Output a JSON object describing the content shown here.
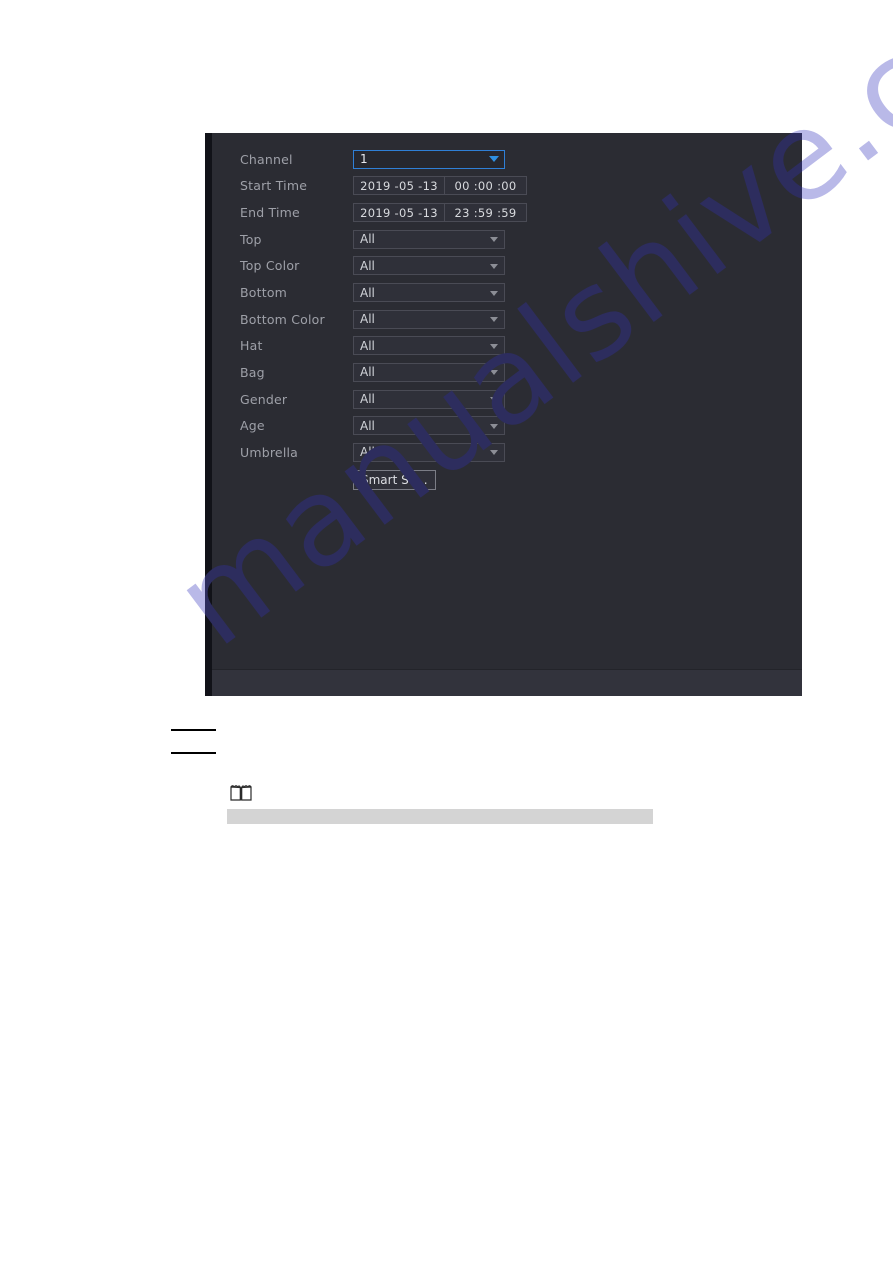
{
  "watermark": {
    "text": "manualshive.com",
    "color_on_white": "#b9b9e8",
    "color_on_dialog": "#2d2d5e"
  },
  "dialog": {
    "background": "#2b2c33",
    "footer_background": "#32333c",
    "accent_color": "#2f8fe0",
    "rows": [
      {
        "label": "Channel",
        "control": "select",
        "value": "1",
        "focused": true,
        "icon": "chevron-down-icon",
        "name": "channel"
      },
      {
        "label": "Start Time",
        "control": "datetime",
        "date": "2019 -05 -13",
        "time": "00 :00 :00",
        "name": "start-time"
      },
      {
        "label": "End Time",
        "control": "datetime",
        "date": "2019 -05 -13",
        "time": "23 :59 :59",
        "name": "end-time"
      },
      {
        "label": "Top",
        "control": "select",
        "value": "All",
        "focused": false,
        "icon": "chevron-down-icon",
        "name": "top"
      },
      {
        "label": "Top Color",
        "control": "select",
        "value": "All",
        "focused": false,
        "icon": "chevron-down-icon",
        "name": "top-color"
      },
      {
        "label": "Bottom",
        "control": "select",
        "value": "All",
        "focused": false,
        "icon": "chevron-down-icon",
        "name": "bottom"
      },
      {
        "label": "Bottom Color",
        "control": "select",
        "value": "All",
        "focused": false,
        "icon": "chevron-down-icon",
        "name": "bottom-color"
      },
      {
        "label": "Hat",
        "control": "select",
        "value": "All",
        "focused": false,
        "icon": "chevron-down-icon",
        "name": "hat"
      },
      {
        "label": "Bag",
        "control": "select",
        "value": "All",
        "focused": false,
        "icon": "chevron-down-icon",
        "name": "bag"
      },
      {
        "label": "Gender",
        "control": "select",
        "value": "All",
        "focused": false,
        "icon": "chevron-down-icon",
        "name": "gender"
      },
      {
        "label": "Age",
        "control": "select",
        "value": "All",
        "focused": false,
        "icon": "chevron-down-icon",
        "name": "age"
      },
      {
        "label": "Umbrella",
        "control": "select",
        "value": "All",
        "focused": false,
        "icon": "chevron-down-icon",
        "name": "umbrella"
      }
    ],
    "action_button": {
      "label": "Smart Se...",
      "name": "smart-search-button"
    }
  },
  "page_notes": {
    "note_icon": "book-icon",
    "redacted_text": ""
  }
}
